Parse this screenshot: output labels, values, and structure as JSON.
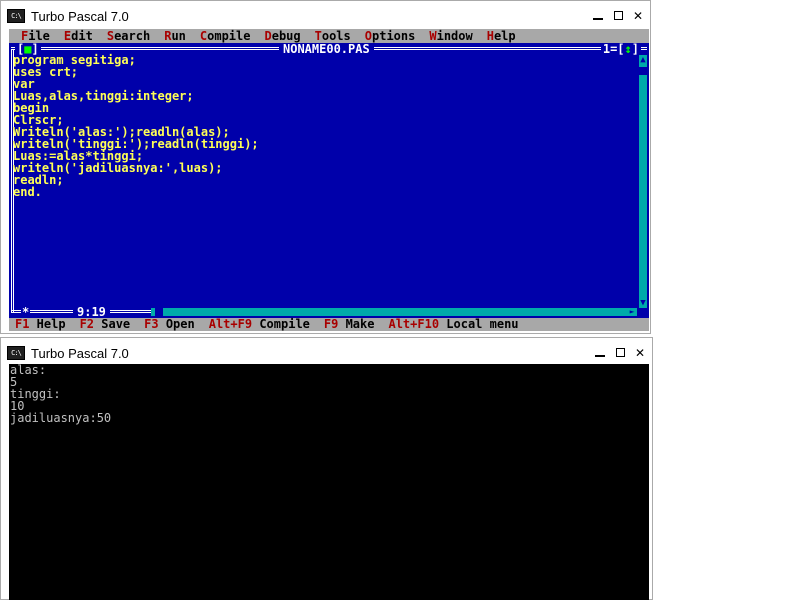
{
  "ide_window": {
    "title": "Turbo Pascal 7.0",
    "icon_text": "C:\\",
    "menu": [
      {
        "hotkey": "F",
        "rest": "ile"
      },
      {
        "hotkey": "E",
        "rest": "dit"
      },
      {
        "hotkey": "S",
        "rest": "earch"
      },
      {
        "hotkey": "R",
        "rest": "un"
      },
      {
        "hotkey": "C",
        "rest": "ompile"
      },
      {
        "hotkey": "D",
        "rest": "ebug"
      },
      {
        "hotkey": "T",
        "rest": "ools"
      },
      {
        "hotkey": "O",
        "rest": "ptions"
      },
      {
        "hotkey": "W",
        "rest": "indow"
      },
      {
        "hotkey": "H",
        "rest": "elp"
      }
    ],
    "editor": {
      "file_name": "NONAME00.PAS",
      "close_box_left": "[",
      "close_box_mark": "■",
      "close_box_right": "]",
      "window_number": "1=[",
      "zoom_mark": "↕",
      "zoom_close": "]",
      "code_lines": [
        "program segitiga;",
        "uses crt;",
        "var",
        "Luas,alas,tinggi:integer;",
        "begin",
        "Clrscr;",
        "Writeln('alas:');readln(alas);",
        "writeln('tinggi:');readln(tinggi);",
        "Luas:=alas*tinggi;",
        "writeln('jadiluasnya:',luas);",
        "readln;",
        "end."
      ],
      "modified_mark": "*",
      "cursor_position": "9:19"
    },
    "status_bar": [
      {
        "key": "F1",
        "label": "Help"
      },
      {
        "key": "F2",
        "label": "Save"
      },
      {
        "key": "F3",
        "label": "Open"
      },
      {
        "key": "Alt+F9",
        "label": "Compile"
      },
      {
        "key": "F9",
        "label": "Make"
      },
      {
        "key": "Alt+F10",
        "label": "Local menu"
      }
    ]
  },
  "output_window": {
    "title": "Turbo Pascal 7.0",
    "icon_text": "C:\\",
    "lines": [
      "alas:",
      "5",
      "tinggi:",
      "10",
      "jadiluasnya:50"
    ]
  },
  "colors": {
    "ide_background": "#0000aa",
    "code_text": "#ffff55",
    "menu_background": "#a8a8a8",
    "hotkey_red": "#a80000",
    "scrollbar": "#00aaaa",
    "console_background": "#000000",
    "console_text": "#c0c0c0"
  }
}
